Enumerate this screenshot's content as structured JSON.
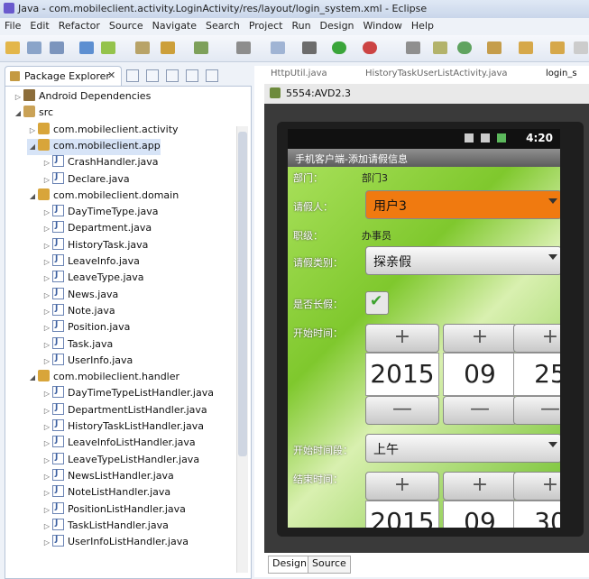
{
  "window": {
    "title": "Java - com.mobileclient.activity.LoginActivity/res/layout/login_system.xml - Eclipse"
  },
  "menubar": [
    "File",
    "Edit",
    "Refactor",
    "Source",
    "Navigate",
    "Search",
    "Project",
    "Run",
    "Design",
    "Window",
    "Help"
  ],
  "package_explorer": {
    "tab_label": "Package Explorer",
    "close_glyph": "✕",
    "tree": [
      {
        "label": "Android Dependencies",
        "level": 1,
        "icon": "library-icon",
        "expanded": false
      },
      {
        "label": "src",
        "level": 1,
        "icon": "source-folder-icon",
        "expanded": true
      },
      {
        "label": "com.mobileclient.activity",
        "level": 2,
        "icon": "package-icon",
        "expanded": false
      },
      {
        "label": "com.mobileclient.app",
        "level": 2,
        "icon": "package-icon",
        "expanded": true,
        "selected": true
      },
      {
        "label": "CrashHandler.java",
        "level": 3,
        "icon": "java-file-icon",
        "expanded": false
      },
      {
        "label": "Declare.java",
        "level": 3,
        "icon": "java-file-icon",
        "expanded": false
      },
      {
        "label": "com.mobileclient.domain",
        "level": 2,
        "icon": "package-icon",
        "expanded": true
      },
      {
        "label": "DayTimeType.java",
        "level": 3,
        "icon": "java-file-icon",
        "expanded": false
      },
      {
        "label": "Department.java",
        "level": 3,
        "icon": "java-file-icon",
        "expanded": false
      },
      {
        "label": "HistoryTask.java",
        "level": 3,
        "icon": "java-file-icon",
        "expanded": false
      },
      {
        "label": "LeaveInfo.java",
        "level": 3,
        "icon": "java-file-icon",
        "expanded": false
      },
      {
        "label": "LeaveType.java",
        "level": 3,
        "icon": "java-file-icon",
        "expanded": false
      },
      {
        "label": "News.java",
        "level": 3,
        "icon": "java-file-icon",
        "expanded": false
      },
      {
        "label": "Note.java",
        "level": 3,
        "icon": "java-file-icon",
        "expanded": false
      },
      {
        "label": "Position.java",
        "level": 3,
        "icon": "java-file-icon",
        "expanded": false
      },
      {
        "label": "Task.java",
        "level": 3,
        "icon": "java-file-icon",
        "expanded": false
      },
      {
        "label": "UserInfo.java",
        "level": 3,
        "icon": "java-file-icon",
        "expanded": false
      },
      {
        "label": "com.mobileclient.handler",
        "level": 2,
        "icon": "package-icon",
        "expanded": true
      },
      {
        "label": "DayTimeTypeListHandler.java",
        "level": 3,
        "icon": "java-file-icon",
        "expanded": false
      },
      {
        "label": "DepartmentListHandler.java",
        "level": 3,
        "icon": "java-file-icon",
        "expanded": false
      },
      {
        "label": "HistoryTaskListHandler.java",
        "level": 3,
        "icon": "java-file-icon",
        "expanded": false
      },
      {
        "label": "LeaveInfoListHandler.java",
        "level": 3,
        "icon": "java-file-icon",
        "expanded": false
      },
      {
        "label": "LeaveTypeListHandler.java",
        "level": 3,
        "icon": "java-file-icon",
        "expanded": false
      },
      {
        "label": "NewsListHandler.java",
        "level": 3,
        "icon": "java-file-icon",
        "expanded": false
      },
      {
        "label": "NoteListHandler.java",
        "level": 3,
        "icon": "java-file-icon",
        "expanded": false
      },
      {
        "label": "PositionListHandler.java",
        "level": 3,
        "icon": "java-file-icon",
        "expanded": false
      },
      {
        "label": "TaskListHandler.java",
        "level": 3,
        "icon": "java-file-icon",
        "expanded": false
      },
      {
        "label": "UserInfoListHandler.java",
        "level": 3,
        "icon": "java-file-icon",
        "expanded": false
      }
    ]
  },
  "editor_tabs": [
    "HttpUtil.java",
    "HistoryTaskUserListActivity.java",
    "login_s"
  ],
  "emulator": {
    "window_title": "5554:AVD2.3",
    "clock": "4:20",
    "app_title": "手机客户端-添加请假信息",
    "form": {
      "department_label": "部门：",
      "department_value": "部门3",
      "requester_label": "请假人：",
      "requester_value": "用户3",
      "position_label": "职级：",
      "position_value": "办事员",
      "leave_type_label": "请假类别：",
      "leave_type_value": "探亲假",
      "long_leave_label": "是否长假：",
      "start_time_label": "开始时间：",
      "start_date": {
        "year": "2015",
        "month": "09",
        "day": "25"
      },
      "start_period_label": "开始时间段：",
      "start_period_value": "上午",
      "end_time_label": "结束时间：",
      "end_date": {
        "year": "2015",
        "month": "09",
        "day": "30"
      },
      "plus": "+",
      "minus": "—"
    }
  },
  "bottom_tabs": {
    "design": "Design",
    "source": "Source"
  },
  "colors": {
    "orange_spinner": "#f07a10",
    "accent_green": "#7fc82d"
  }
}
